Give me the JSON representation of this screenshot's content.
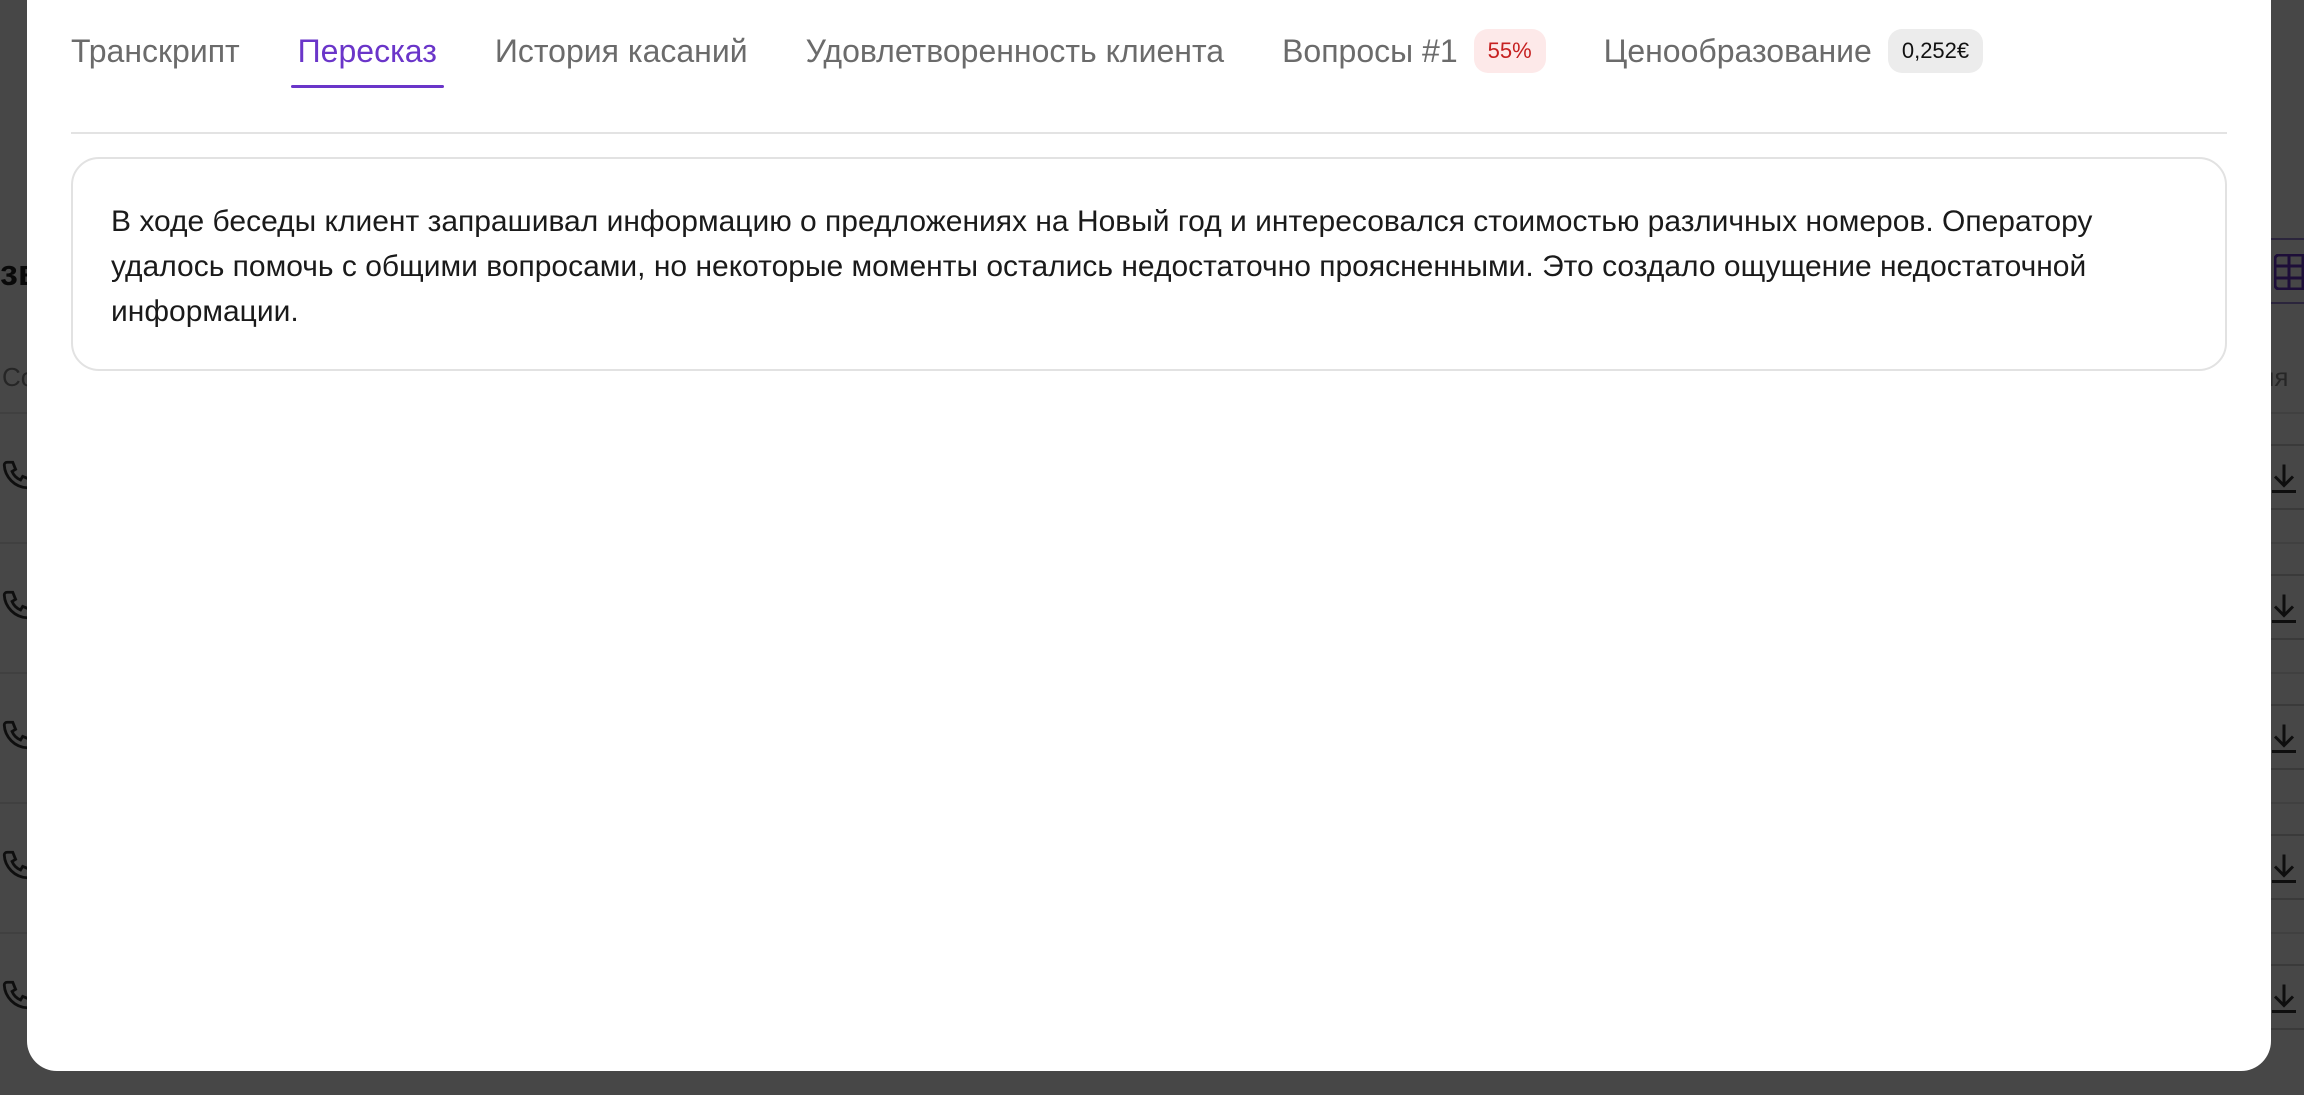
{
  "tabs": [
    {
      "label": "Транскрипт",
      "active": false
    },
    {
      "label": "Пересказ",
      "active": true
    },
    {
      "label": "История касаний",
      "active": false
    },
    {
      "label": "Удовлетворенность клиента",
      "active": false
    },
    {
      "label": "Вопросы #1",
      "active": false,
      "badge": "55%"
    },
    {
      "label": "Ценообразование",
      "active": false,
      "badge": "0,252€"
    }
  ],
  "summary": {
    "text": "В ходе беседы клиент запрашивал информацию о предложениях на Новый год и интересовался стоимостью различных номеров. Оператору удалось помочь с общими вопросами, но некоторые моменты остались недостаточно проясненными. Это создало ощущение недостаточной информации."
  },
  "background": {
    "heading_fragment": "зв",
    "left_column_fragment": "Со",
    "right_column_fragment": "ня"
  },
  "colors": {
    "accent": "#6a35c9",
    "badge_red_bg": "#fde9e9",
    "badge_red_text": "#c62020",
    "badge_gray_bg": "#ececec"
  }
}
